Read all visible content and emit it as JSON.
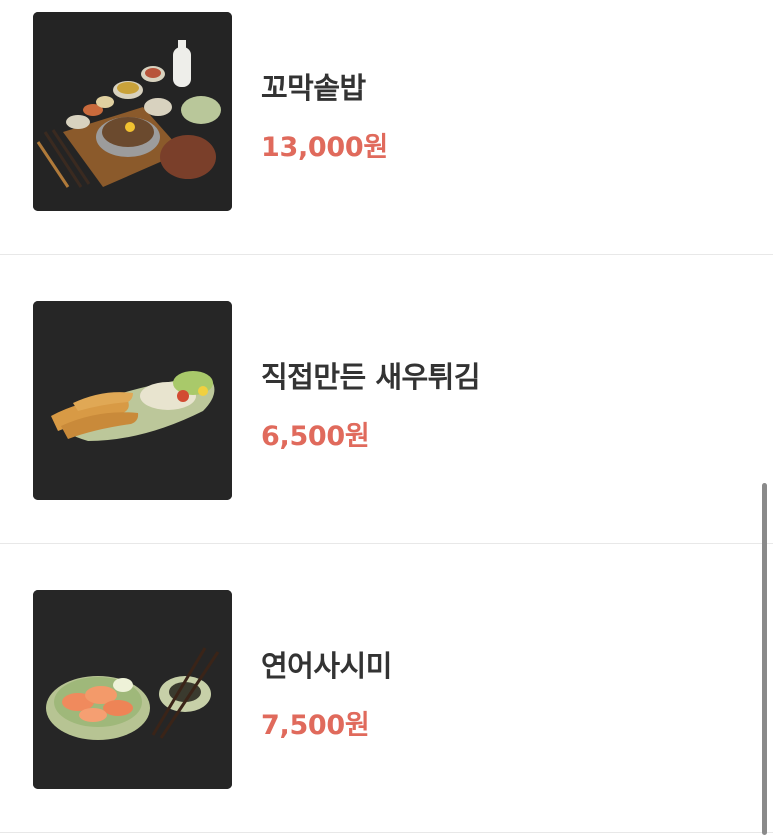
{
  "menu": {
    "items": [
      {
        "name": "꼬막솥밥",
        "price": "13,000원",
        "image": "bibimbap-set-photo"
      },
      {
        "name": "직접만든 새우튀김",
        "price": "6,500원",
        "image": "fried-shrimp-photo"
      },
      {
        "name": "연어사시미",
        "price": "7,500원",
        "image": "salmon-sashimi-photo"
      }
    ]
  },
  "colors": {
    "price": "#e06a5c",
    "name": "#333333",
    "divider": "#e8e8e8",
    "background": "#ffffff"
  }
}
